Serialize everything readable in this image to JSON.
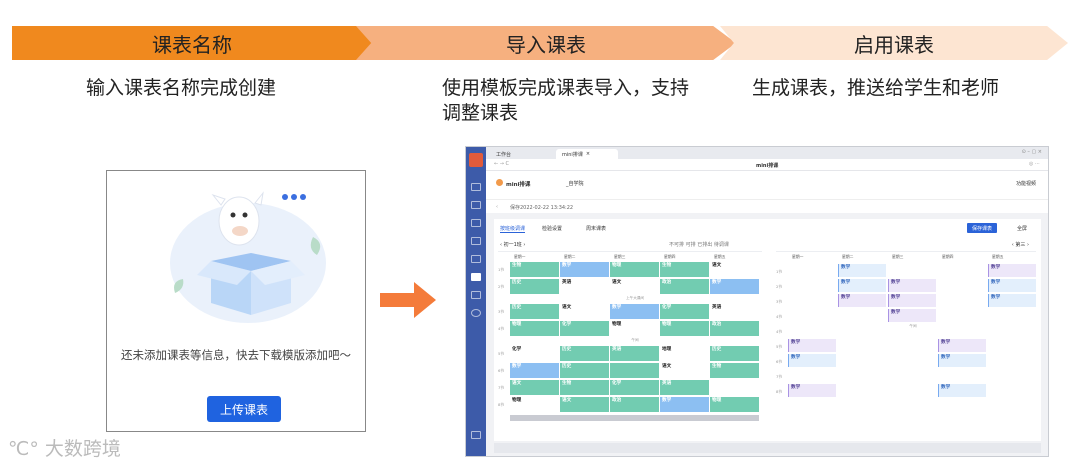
{
  "steps": [
    {
      "title": "课表名称",
      "desc": "输入课表名称完成创建"
    },
    {
      "title": "导入课表",
      "desc": "使用模板完成课表导入，支持调整课表"
    },
    {
      "title": "启用课表",
      "desc": "生成课表，推送给学生和老师"
    }
  ],
  "empty_state": {
    "message": "还未添加课表等信息，快去下载模版添加吧～",
    "upload_button": "上传课表"
  },
  "watermark": "大数跨境",
  "colors": {
    "step1": "#f0891e",
    "step2": "#f6b07f",
    "step3": "#fde5d2",
    "primary": "#1f63e0",
    "arrow": "#f47b3a",
    "sidebar": "#3d5ba9"
  },
  "app": {
    "tabs": [
      "工作台",
      "mini排课"
    ],
    "window_title": "mini排课",
    "app_name": "mini排课",
    "school": "_自学院",
    "feature_intro": "功能视频",
    "edited_at": "保存2022-02-22 13:34:22",
    "toolbar_tabs": [
      "按班级调课",
      "检验设置",
      "周末课表"
    ],
    "save_button": "保存课表",
    "fullscreen": "全屏",
    "week_selector": "初一1班",
    "week_right": "第三",
    "legend": [
      "不可排",
      "可排",
      "已排出",
      "待调课"
    ],
    "days": [
      "星期一",
      "星期二",
      "星期三",
      "星期四",
      "星期五"
    ],
    "periods": [
      "1节",
      "2节",
      "3节",
      "4节",
      "5节",
      "6节",
      "7节",
      "8节"
    ],
    "breaks": [
      "上午大课间",
      "午间"
    ],
    "left_rows": [
      [
        {
          "s": "生物",
          "t": "g"
        },
        {
          "s": "数学",
          "t": "bl"
        },
        {
          "s": "物理",
          "t": "g"
        },
        {
          "s": "生物",
          "t": "g"
        },
        {
          "s": "语文",
          "t": "w"
        }
      ],
      [
        {
          "s": "历史",
          "t": "g"
        },
        {
          "s": "英语",
          "t": "w"
        },
        {
          "s": "语文",
          "t": "w"
        },
        {
          "s": "政治",
          "t": "g"
        },
        {
          "s": "数学",
          "t": "bl"
        }
      ],
      [
        {
          "s": "历史",
          "t": "g"
        },
        {
          "s": "语文",
          "t": "w"
        },
        {
          "s": "数学",
          "t": "bl"
        },
        {
          "s": "化学",
          "t": "g"
        },
        {
          "s": "英语",
          "t": "w"
        }
      ],
      [
        {
          "s": "物理",
          "t": "g"
        },
        {
          "s": "化学",
          "t": "g"
        },
        {
          "s": "物理",
          "t": "w"
        },
        {
          "s": "物理",
          "t": "g"
        },
        {
          "s": "政治",
          "t": "g"
        }
      ],
      [
        {
          "s": "化学",
          "t": "w"
        },
        {
          "s": "历史",
          "t": "g"
        },
        {
          "s": "英语",
          "t": "g"
        },
        {
          "s": "地理",
          "t": "w"
        },
        {
          "s": "历史",
          "t": "g"
        }
      ],
      [
        {
          "s": "数学",
          "t": "bl"
        },
        {
          "s": "历史",
          "t": "g"
        },
        {
          "s": "",
          "t": "g"
        },
        {
          "s": "语文",
          "t": "w"
        },
        {
          "s": "生物",
          "t": "g"
        }
      ],
      [
        {
          "s": "语文",
          "t": "g"
        },
        {
          "s": "生物",
          "t": "g"
        },
        {
          "s": "化学",
          "t": "g"
        },
        {
          "s": "英语",
          "t": "g"
        },
        {
          "s": "",
          "t": "w"
        }
      ],
      [
        {
          "s": "物理",
          "t": "w"
        },
        {
          "s": "语文",
          "t": "g"
        },
        {
          "s": "政治",
          "t": "g"
        },
        {
          "s": "数学",
          "t": "bl"
        },
        {
          "s": "物理",
          "t": "g"
        }
      ]
    ],
    "sub_label": "数学"
  }
}
